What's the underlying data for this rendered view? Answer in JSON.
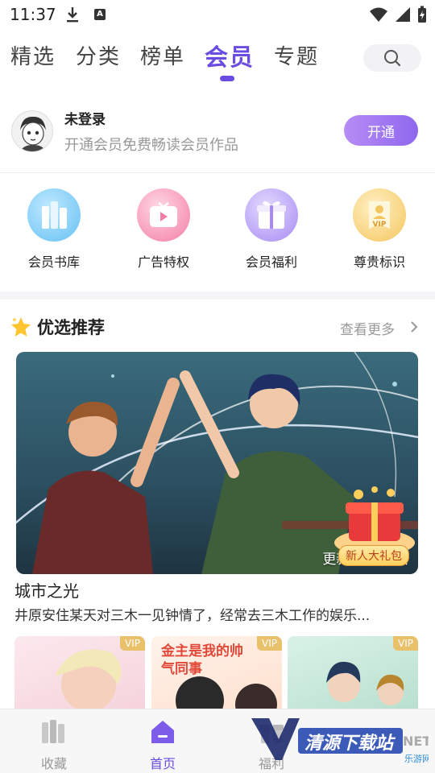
{
  "status_bar": {
    "time": "11:37",
    "a_badge": "A"
  },
  "tabs": [
    {
      "label": "精选",
      "active": false
    },
    {
      "label": "分类",
      "active": false
    },
    {
      "label": "榜单",
      "active": false
    },
    {
      "label": "会员",
      "active": true
    },
    {
      "label": "专题",
      "active": false
    }
  ],
  "user": {
    "name": "未登录",
    "subtitle": "开通会员免费畅读会员作品",
    "open_button": "开通"
  },
  "features": [
    {
      "label": "会员书库",
      "icon": "books-icon",
      "color": "#5ab8f0"
    },
    {
      "label": "广告特权",
      "icon": "play-tv-icon",
      "color": "#f57aa4"
    },
    {
      "label": "会员福利",
      "icon": "gift-icon",
      "color": "#a78bf2"
    },
    {
      "label": "尊贵标识",
      "icon": "vip-badge-icon",
      "color": "#f2c25d"
    }
  ],
  "recommend": {
    "title": "优选推荐",
    "more": "查看更多",
    "banner_update": "更新至第29话",
    "gift_label": "新人大礼包",
    "book_title": "城市之光",
    "book_desc": "井原安住某天对三木一见钟情了，经常去三木工作的娱乐..."
  },
  "thumbs": [
    {
      "vip": "VIP",
      "title": ""
    },
    {
      "vip": "VIP",
      "title": "金主是我的帅气同事"
    },
    {
      "vip": "VIP",
      "title": ""
    }
  ],
  "nav": [
    {
      "label": "收藏",
      "icon": "bookshelf-icon",
      "active": false
    },
    {
      "label": "首页",
      "icon": "home-icon",
      "active": true
    },
    {
      "label": "福利",
      "icon": "gift-icon",
      "active": false
    }
  ],
  "watermark": {
    "text": "清源下载站",
    "sub": "NET",
    "sub2": "乐游网"
  },
  "colors": {
    "accent": "#6a4ce0",
    "open_grad_start": "#b78cf6",
    "open_grad_end": "#8f67ee"
  }
}
